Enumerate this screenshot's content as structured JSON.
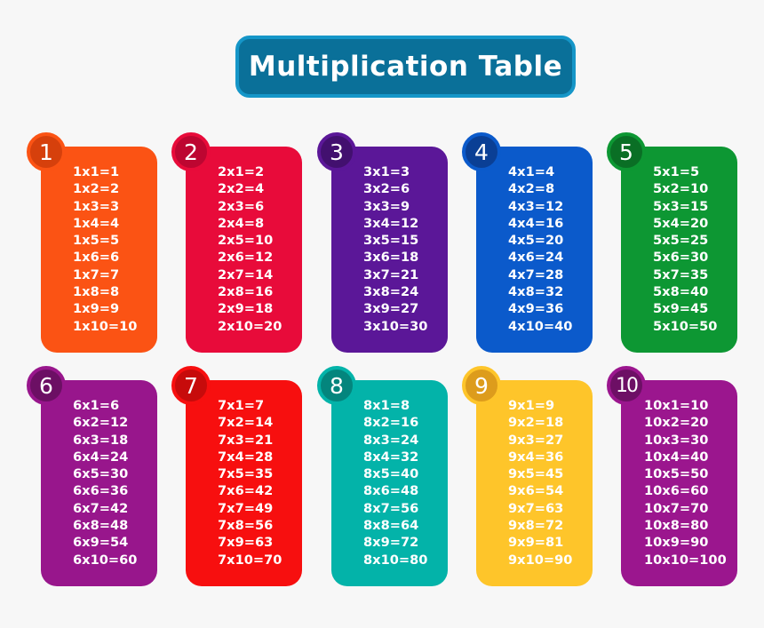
{
  "title": "Multiplication Table",
  "cards": [
    {
      "number": "1",
      "color": "#fb5314",
      "badge_color": "#d6400c",
      "lines": [
        "1x1=1",
        "1x2=2",
        "1x3=3",
        "1x4=4",
        "1x5=5",
        "1x6=6",
        "1x7=7",
        "1x8=8",
        "1x9=9",
        "1x10=10"
      ]
    },
    {
      "number": "2",
      "color": "#e80b3a",
      "badge_color": "#bd0631",
      "lines": [
        "2x1=2",
        "2x2=4",
        "2x3=6",
        "2x4=8",
        "2x5=10",
        "2x6=12",
        "2x7=14",
        "2x8=16",
        "2x9=18",
        "2x10=20"
      ]
    },
    {
      "number": "3",
      "color": "#5b1798",
      "badge_color": "#42106f",
      "lines": [
        "3x1=3",
        "3x2=6",
        "3x3=9",
        "3x4=12",
        "3x5=15",
        "3x6=18",
        "3x7=21",
        "3x8=24",
        "3x9=27",
        "3x10=30"
      ]
    },
    {
      "number": "4",
      "color": "#0b5acb",
      "badge_color": "#0a3f95",
      "lines": [
        "4x1=4",
        "4x2=8",
        "4x3=12",
        "4x4=16",
        "4x5=20",
        "4x6=24",
        "4x7=28",
        "4x8=32",
        "4x9=36",
        "4x10=40"
      ]
    },
    {
      "number": "5",
      "color": "#0d9733",
      "badge_color": "#0a6f25",
      "lines": [
        "5x1=5",
        "5x2=10",
        "5x3=15",
        "5x4=20",
        "5x5=25",
        "5x6=30",
        "5x7=35",
        "5x8=40",
        "5x9=45",
        "5x10=50"
      ]
    },
    {
      "number": "6",
      "color": "#98168c",
      "badge_color": "#6c0f64",
      "lines": [
        "6x1=6",
        "6x2=12",
        "6x3=18",
        "6x4=24",
        "6x5=30",
        "6x6=36",
        "6x7=42",
        "6x8=48",
        "6x9=54",
        "6x10=60"
      ]
    },
    {
      "number": "7",
      "color": "#f70f0f",
      "badge_color": "#c70b0b",
      "lines": [
        "7x1=7",
        "7x2=14",
        "7x3=21",
        "7x4=28",
        "7x5=35",
        "7x6=42",
        "7x7=49",
        "7x8=56",
        "7x9=63",
        "7x10=70"
      ]
    },
    {
      "number": "8",
      "color": "#03b3a9",
      "badge_color": "#04857d",
      "lines": [
        "8x1=8",
        "8x2=16",
        "8x3=24",
        "8x4=32",
        "8x5=40",
        "8x6=48",
        "8x7=56",
        "8x8=64",
        "8x9=72",
        "8x10=80"
      ]
    },
    {
      "number": "9",
      "color": "#fec52a",
      "badge_color": "#dd9c1c",
      "lines": [
        "9x1=9",
        "9x2=18",
        "9x3=27",
        "9x4=36",
        "9x5=45",
        "9x6=54",
        "9x7=63",
        "9x8=72",
        "9x9=81",
        "9x10=90"
      ]
    },
    {
      "number": "10",
      "color": "#9b168e",
      "badge_color": "#6d0f65",
      "lines": [
        "10x1=10",
        "10x2=20",
        "10x3=30",
        "10x4=40",
        "10x5=50",
        "10x6=60",
        "10x7=70",
        "10x8=80",
        "10x9=90",
        "10x10=100"
      ]
    }
  ]
}
